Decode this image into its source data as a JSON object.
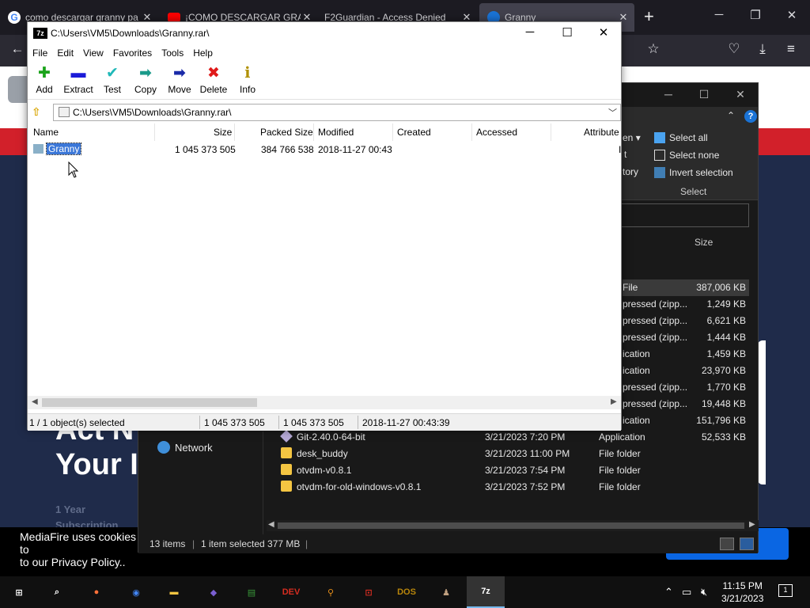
{
  "browser": {
    "tabs": [
      {
        "title": "como descargar granny pa",
        "icon_color": "#4285f4"
      },
      {
        "title": "¡COMO DESCARGAR GRAN",
        "icon_color": "#ff0000"
      },
      {
        "title": "F2Guardian - Access Denied",
        "icon_color": ""
      },
      {
        "title": "Granny",
        "icon_color": "#1a73d6"
      }
    ],
    "new_tab": "+"
  },
  "webpage": {
    "hero_line1": "Act N",
    "hero_line2": "Your I",
    "faded_text": "1 Year",
    "faded_text2": "Subscription",
    "cookie_text": "MediaFire uses cookies to",
    "cookie_text2": "to our Privacy Policy.."
  },
  "explorer": {
    "ribbon": {
      "open_label": "en",
      "select_all": "Select all",
      "select_none": "Select none",
      "invert_selection": "Invert selection",
      "select_group": "Select",
      "t_label": "t",
      "history_label": "tory"
    },
    "size_header": "Size",
    "network_label": "Network",
    "rows": [
      {
        "type": "File",
        "size": "387,006 KB"
      },
      {
        "type": "pressed (zipp...",
        "size": "1,249 KB"
      },
      {
        "type": "pressed (zipp...",
        "size": "6,621 KB"
      },
      {
        "type": "pressed (zipp...",
        "size": "1,444 KB"
      },
      {
        "type": "ication",
        "size": "1,459 KB"
      },
      {
        "type": "ication",
        "size": "23,970 KB"
      },
      {
        "type": "pressed (zipp...",
        "size": "1,770 KB"
      },
      {
        "type": "pressed (zipp...",
        "size": "19,448 KB"
      },
      {
        "type": "ication",
        "size": "151,796 KB"
      }
    ],
    "full_rows": [
      {
        "name": "Git-2.40.0-64-bit",
        "date": "3/21/2023 7:20 PM",
        "type": "Application",
        "size": "52,533 KB",
        "icon": "git"
      },
      {
        "name": "desk_buddy",
        "date": "3/21/2023 11:00 PM",
        "type": "File folder",
        "size": "",
        "icon": "folder"
      },
      {
        "name": "otvdm-v0.8.1",
        "date": "3/21/2023 7:54 PM",
        "type": "File folder",
        "size": "",
        "icon": "folder"
      },
      {
        "name": "otvdm-for-old-windows-v0.8.1",
        "date": "3/21/2023 7:52 PM",
        "type": "File folder",
        "size": "",
        "icon": "folder"
      }
    ],
    "status": {
      "items": "13 items",
      "selected": "1 item selected  377 MB"
    }
  },
  "sevenzip": {
    "title": "C:\\Users\\VM5\\Downloads\\Granny.rar\\",
    "logo": "7z",
    "menu": [
      "File",
      "Edit",
      "View",
      "Favorites",
      "Tools",
      "Help"
    ],
    "toolbar": [
      {
        "label": "Add",
        "icon": "plus-icon",
        "glyph": "✚",
        "color": "#1aa31a"
      },
      {
        "label": "Extract",
        "icon": "minus-icon",
        "glyph": "▬",
        "color": "#1b1bd8"
      },
      {
        "label": "Test",
        "icon": "check-icon",
        "glyph": "✔",
        "color": "#20b8b8"
      },
      {
        "label": "Copy",
        "icon": "arrow-copy-icon",
        "glyph": "➡",
        "color": "#1a9a8a"
      },
      {
        "label": "Move",
        "icon": "arrow-move-icon",
        "glyph": "➡",
        "color": "#1a2aa8"
      },
      {
        "label": "Delete",
        "icon": "delete-x-icon",
        "glyph": "✖",
        "color": "#e01a1a"
      },
      {
        "label": "Info",
        "icon": "info-icon",
        "glyph": "ℹ",
        "color": "#b09000"
      }
    ],
    "address": "C:\\Users\\VM5\\Downloads\\Granny.rar\\",
    "columns": [
      "Name",
      "Size",
      "Packed Size",
      "Modified",
      "Created",
      "Accessed",
      "Attribute"
    ],
    "items": [
      {
        "name": "Granny",
        "size": "1 045 373 505",
        "packed": "384 766 538",
        "modified": "2018-11-27 00:43",
        "created": "",
        "accessed": "",
        "attr": "I"
      }
    ],
    "status": {
      "selection": "1 / 1 object(s) selected",
      "size": "1 045 373 505",
      "packed": "1 045 373 505",
      "date": "2018-11-27 00:43:39"
    }
  },
  "taskbar": {
    "apps": [
      {
        "name": "start",
        "glyph": "⊞"
      },
      {
        "name": "search",
        "glyph": "⌕"
      },
      {
        "name": "firefox",
        "glyph": "●"
      },
      {
        "name": "chrome",
        "glyph": "◉"
      },
      {
        "name": "file-explorer",
        "glyph": "▬"
      },
      {
        "name": "visual-studio",
        "glyph": "◆"
      },
      {
        "name": "charts",
        "glyph": "▤"
      },
      {
        "name": "dev-cpp",
        "glyph": "DEV"
      },
      {
        "name": "search-tool",
        "glyph": "⚲"
      },
      {
        "name": "app-d",
        "glyph": "⊡"
      },
      {
        "name": "dosbox",
        "glyph": "DOS"
      },
      {
        "name": "app-figures",
        "glyph": "♟"
      },
      {
        "name": "7zip",
        "glyph": "7z"
      }
    ],
    "time": "11:15 PM",
    "date": "3/21/2023",
    "notification_count": "1"
  }
}
